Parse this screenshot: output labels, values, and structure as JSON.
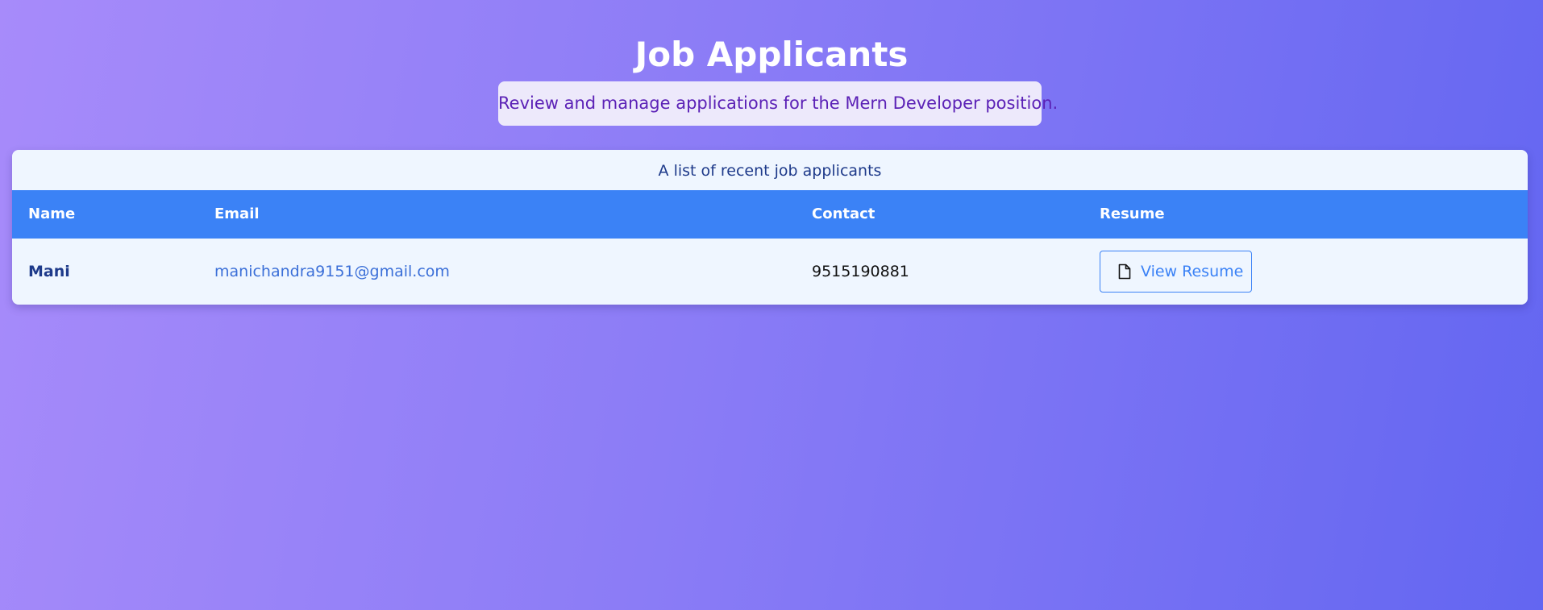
{
  "header": {
    "title": "Job Applicants",
    "subtitle": "Review and manage applications for the Mern Developer position."
  },
  "table": {
    "caption": "A list of recent job applicants",
    "columns": [
      "Name",
      "Email",
      "Contact",
      "Resume"
    ],
    "rows": [
      {
        "name": "Mani",
        "email": "manichandra9151@gmail.com",
        "contact": "9515190881",
        "resume_label": "View Resume",
        "resume_icon": "document-icon"
      }
    ]
  },
  "colors": {
    "background_start": "#a78bfa",
    "background_end": "#6366f1",
    "header_row": "#3b82f6",
    "card": "#eff6ff",
    "subtitle_text": "#5b21b6"
  }
}
